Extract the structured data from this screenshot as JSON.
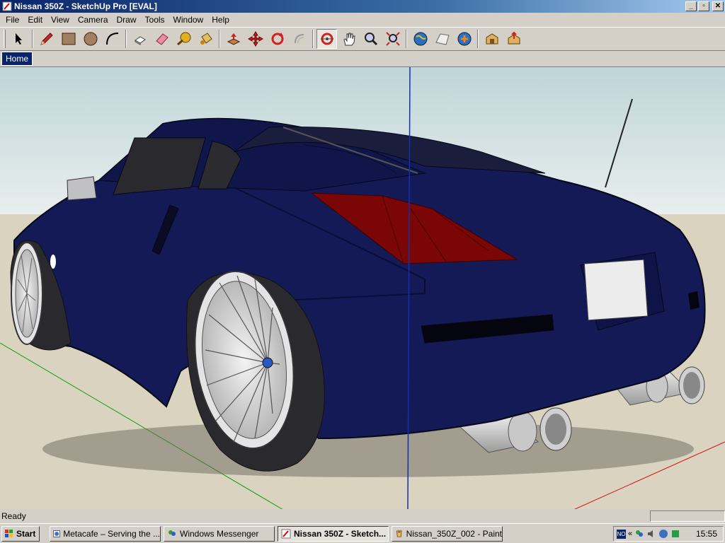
{
  "window": {
    "title": "Nissan 350Z - SketchUp Pro [EVAL]"
  },
  "menu": [
    "File",
    "Edit",
    "View",
    "Camera",
    "Draw",
    "Tools",
    "Window",
    "Help"
  ],
  "toolbar": {
    "tools": [
      {
        "name": "select-tool",
        "icon": "arrow-icon"
      },
      {
        "name": "pencil-tool",
        "icon": "pencil-icon"
      },
      {
        "name": "rectangle-tool",
        "icon": "rectangle-icon"
      },
      {
        "name": "circle-tool",
        "icon": "circle-icon"
      },
      {
        "name": "arc-tool",
        "icon": "arc-icon"
      },
      {
        "name": "make-component-tool",
        "icon": "component-icon"
      },
      {
        "name": "eraser-tool",
        "icon": "eraser-icon"
      },
      {
        "name": "tape-measure-tool",
        "icon": "tape-measure-icon"
      },
      {
        "name": "paint-bucket-tool",
        "icon": "paint-bucket-icon"
      },
      {
        "name": "push-pull-tool",
        "icon": "push-pull-icon"
      },
      {
        "name": "move-tool",
        "icon": "move-icon"
      },
      {
        "name": "rotate-tool",
        "icon": "rotate-icon"
      },
      {
        "name": "offset-tool",
        "icon": "offset-icon"
      },
      {
        "name": "orbit-tool",
        "icon": "orbit-icon"
      },
      {
        "name": "pan-tool",
        "icon": "hand-icon"
      },
      {
        "name": "zoom-tool",
        "icon": "magnifier-icon"
      },
      {
        "name": "zoom-extents-tool",
        "icon": "zoom-extents-icon"
      },
      {
        "name": "get-current-view-tool",
        "icon": "globe-icon"
      },
      {
        "name": "toggle-terrain-tool",
        "icon": "terrain-icon"
      },
      {
        "name": "place-model-tool",
        "icon": "place-model-icon"
      },
      {
        "name": "get-models-tool",
        "icon": "warehouse-icon"
      },
      {
        "name": "share-model-tool",
        "icon": "share-icon"
      }
    ]
  },
  "scenes": {
    "tabs": [
      "Home"
    ]
  },
  "status": {
    "text": "Ready"
  },
  "taskbar": {
    "start_label": "Start",
    "tasks": [
      {
        "label": "Metacafe – Serving the ...",
        "icon": "browser-icon",
        "active": false
      },
      {
        "label": "Windows Messenger",
        "icon": "messenger-icon",
        "active": false
      },
      {
        "label": "Nissan 350Z - Sketch...",
        "icon": "sketchup-icon",
        "active": true
      },
      {
        "label": "Nissan_350Z_002 - Paint",
        "icon": "paint-icon",
        "active": false
      }
    ],
    "tray": {
      "language": "NO",
      "clock": "15:55"
    }
  },
  "colors": {
    "car_body": "#141a56",
    "sky": "#c6d9dc",
    "ground": "#d9d3c0",
    "axis_red": "#d01010",
    "axis_green": "#10a010",
    "axis_blue": "#1030b0"
  }
}
